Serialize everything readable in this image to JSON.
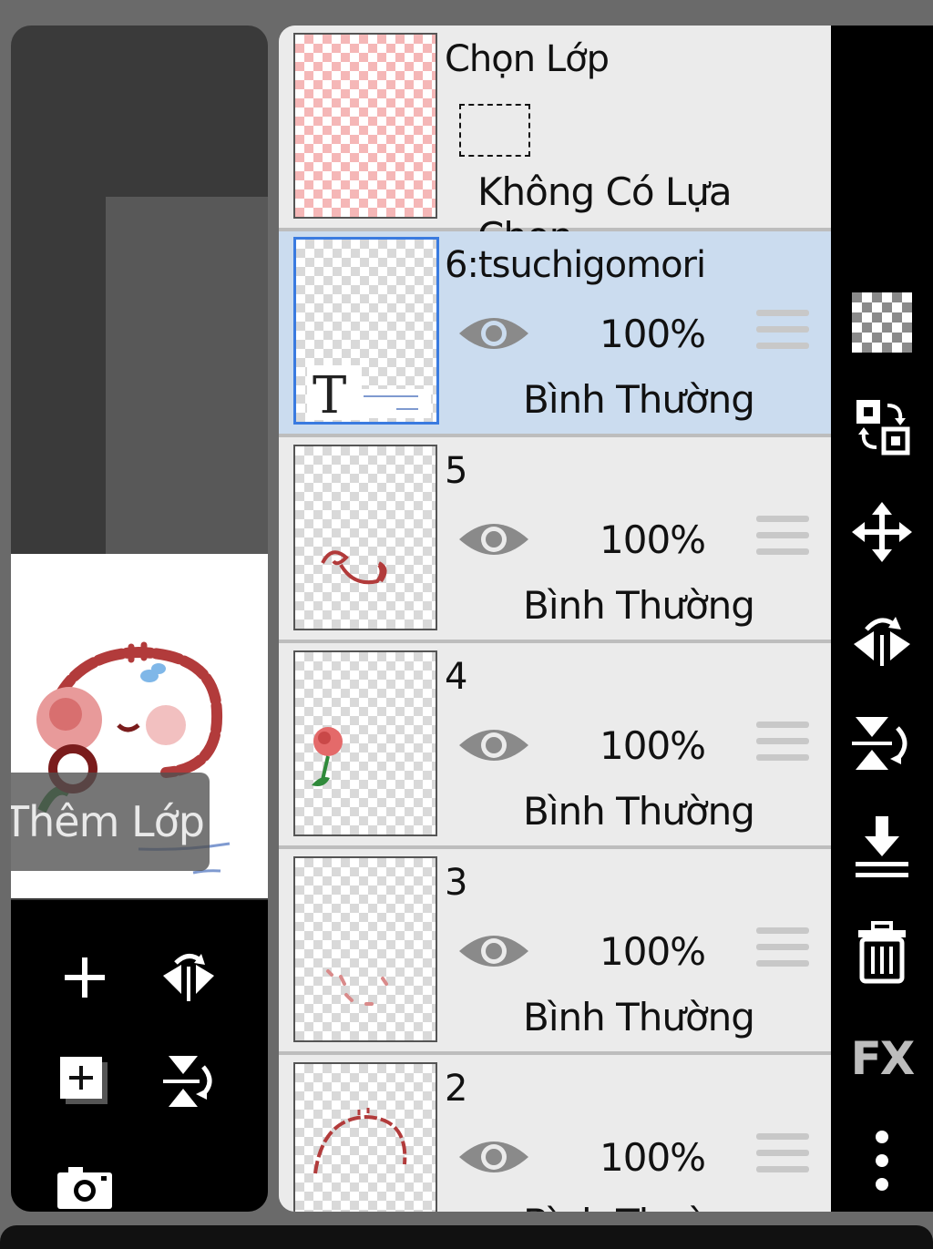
{
  "selection_layer": {
    "title": "Chọn Lớp",
    "status": "Không Có Lựa Chọn"
  },
  "layers": [
    {
      "name": "6:tsuchigomori",
      "opacity": "100%",
      "blend": "Bình Thường",
      "selected": true
    },
    {
      "name": "5",
      "opacity": "100%",
      "blend": "Bình Thường",
      "selected": false
    },
    {
      "name": "4",
      "opacity": "100%",
      "blend": "Bình Thường",
      "selected": false
    },
    {
      "name": "3",
      "opacity": "100%",
      "blend": "Bình Thường",
      "selected": false
    },
    {
      "name": "2",
      "opacity": "100%",
      "blend": "Bình Thường",
      "selected": false
    }
  ],
  "thumb_text_glyph": "T",
  "tooltip": "Thêm Lớp",
  "right_toolbar": {
    "items": [
      "transparency-icon",
      "swap-layer-icon",
      "move-icon",
      "flip-horizontal-icon",
      "flip-vertical-icon",
      "merge-down-icon",
      "trash-icon",
      "fx-button",
      "more-icon"
    ],
    "fx_label": "FX"
  },
  "left_toolbar": {
    "items": [
      "add-layer-icon",
      "flip-horizontal-icon",
      "add-layer-copy-icon",
      "flip-vertical-icon",
      "camera-icon"
    ]
  },
  "colors": {
    "selected_bg": "#cbdcef",
    "selected_border": "#3a7be0",
    "panel_bg": "#ebebeb",
    "toolbar_bg": "#000000"
  }
}
